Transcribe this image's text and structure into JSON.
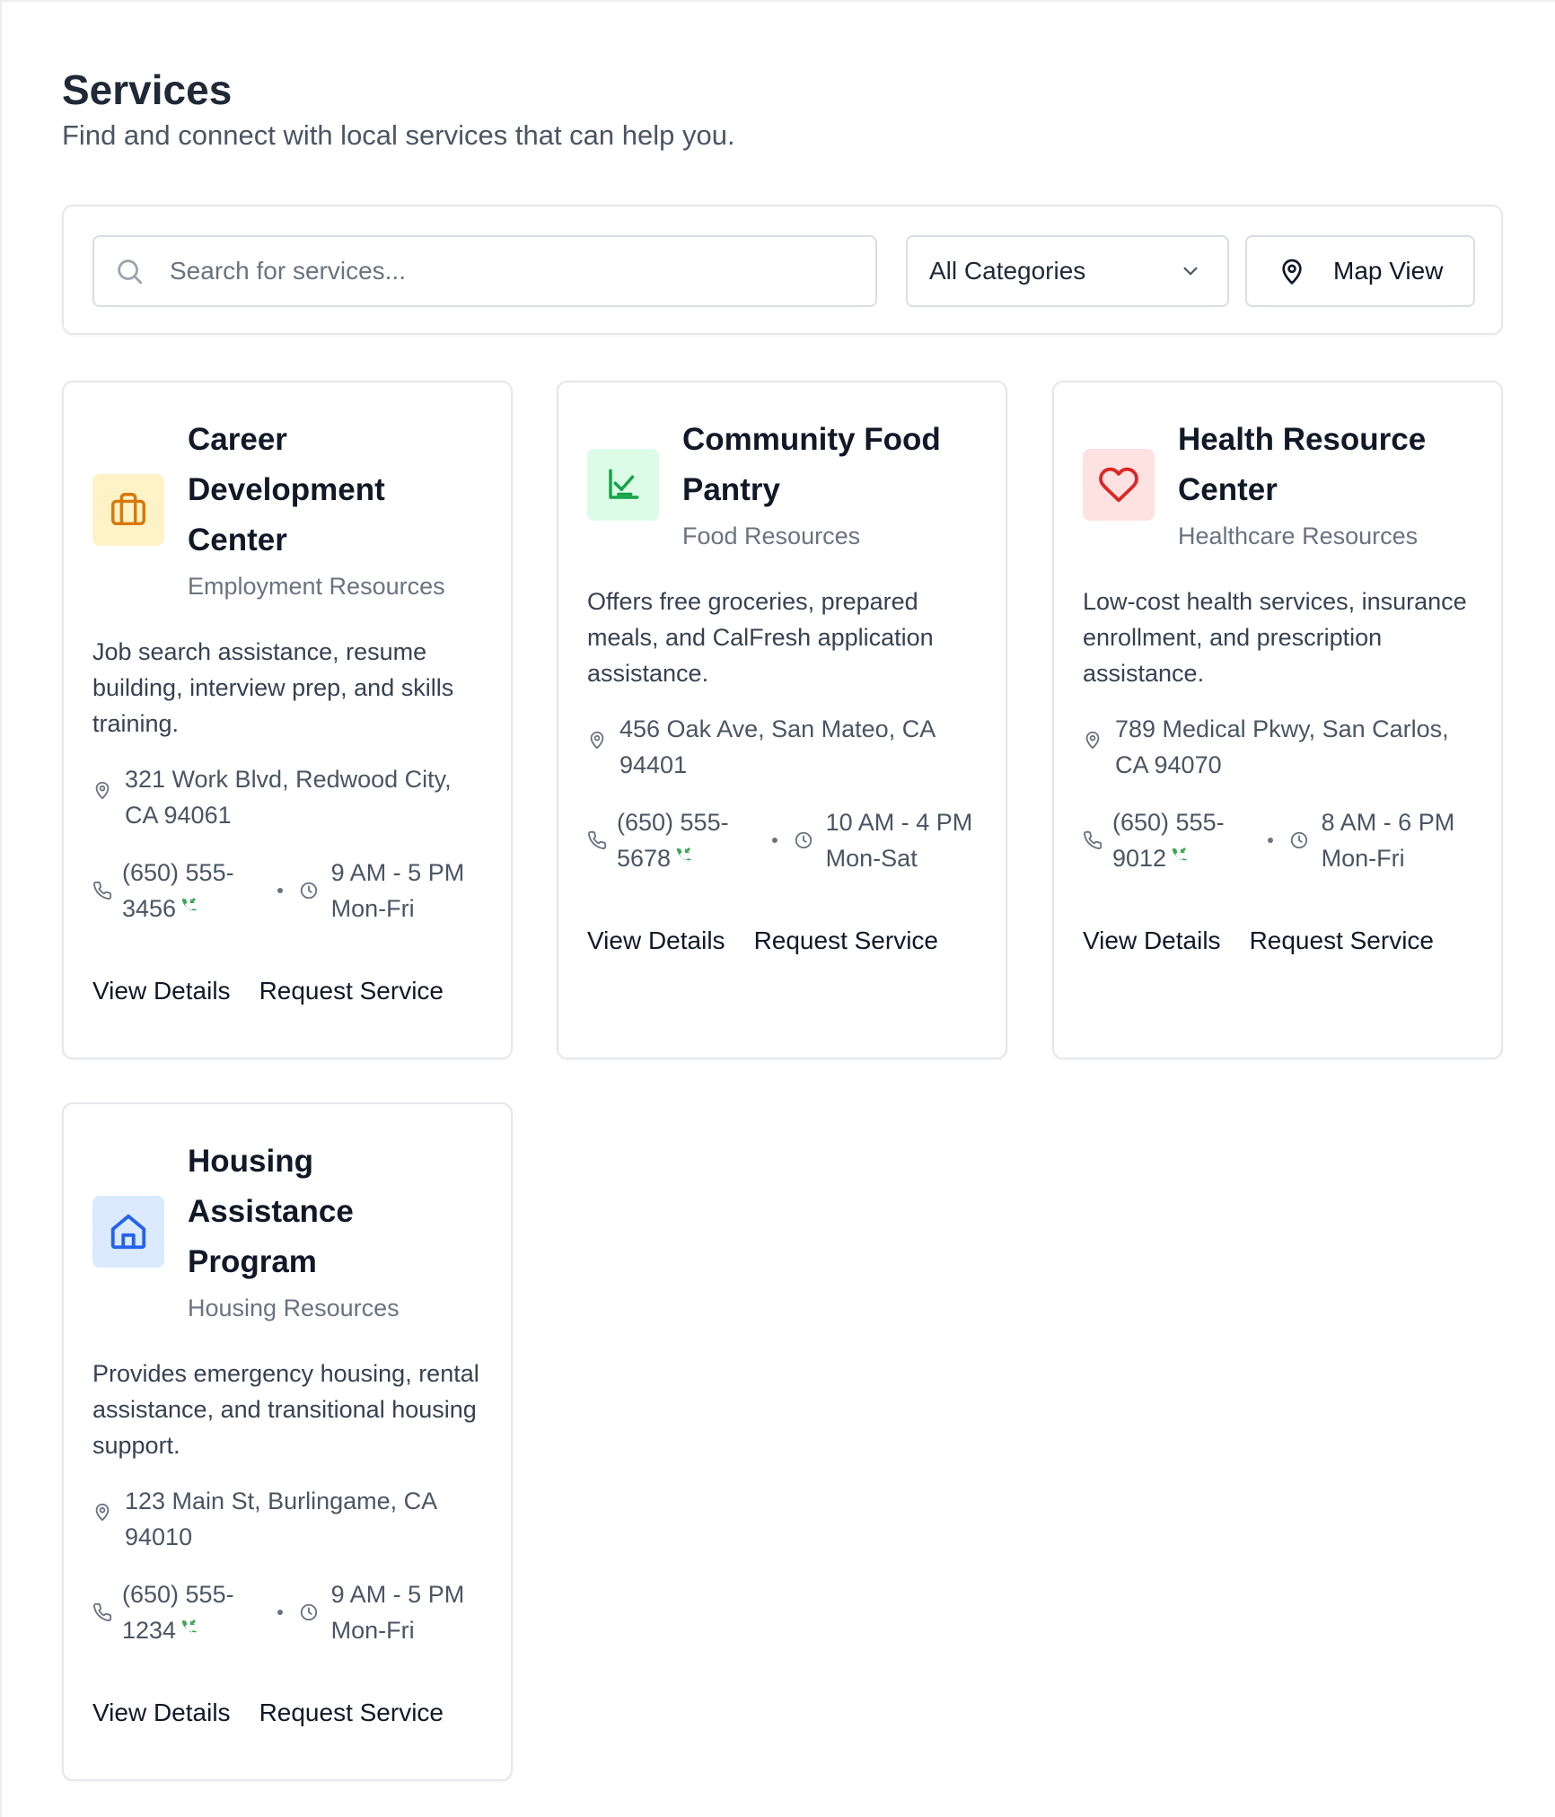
{
  "header": {
    "title": "Services",
    "subtitle": "Find and connect with local services that can help you."
  },
  "toolbar": {
    "search_placeholder": "Search for services...",
    "search_value": "",
    "category_selected": "All Categories",
    "map_view_label": "Map View"
  },
  "cards": [
    {
      "title_lines": [
        "Career",
        "Development",
        "Center"
      ],
      "category": "Employment Resources",
      "description": "Job search assistance, resume building, interview prep, and skills training.",
      "address_lines": [
        "321 Work Blvd, Redwood City,",
        "CA 94061"
      ],
      "phone_lines": [
        "(650) 555-",
        "3456"
      ],
      "hours_lines": [
        "9 AM - 5 PM",
        "Mon-Fri"
      ],
      "icon": "briefcase-icon",
      "icon_bg": "#fef3c7",
      "icon_color": "#d97706",
      "view_label": "View Details",
      "request_label": "Request Service"
    },
    {
      "title_lines": [
        "Community Food",
        "Pantry"
      ],
      "category": "Food Resources",
      "description": "Offers free groceries, prepared meals, and CalFresh application assistance.",
      "address_lines": [
        "456 Oak Ave, San Mateo, CA",
        "94401"
      ],
      "phone_lines": [
        "(650) 555-",
        "5678"
      ],
      "hours_lines": [
        "10 AM - 4 PM",
        "Mon-Sat"
      ],
      "icon": "salad-icon",
      "icon_bg": "#dcfce7",
      "icon_color": "#16a34a",
      "view_label": "View Details",
      "request_label": "Request Service"
    },
    {
      "title_lines": [
        "Health Resource",
        "Center"
      ],
      "category": "Healthcare Resources",
      "description": "Low-cost health services, insurance enrollment, and prescription assistance.",
      "address_lines": [
        "789 Medical Pkwy, San Carlos,",
        "CA 94070"
      ],
      "phone_lines": [
        "(650) 555-",
        "9012"
      ],
      "hours_lines": [
        "8 AM - 6 PM",
        "Mon-Fri"
      ],
      "icon": "heart-icon",
      "icon_bg": "#fee2e2",
      "icon_color": "#dc2626",
      "view_label": "View Details",
      "request_label": "Request Service"
    },
    {
      "title_lines": [
        "Housing",
        "Assistance",
        "Program"
      ],
      "category": "Housing Resources",
      "description": "Provides emergency housing, rental assistance, and transitional housing support.",
      "address_lines": [
        "123 Main St, Burlingame, CA",
        "94010"
      ],
      "phone_lines": [
        "(650) 555-",
        "1234"
      ],
      "hours_lines": [
        "9 AM - 5 PM",
        "Mon-Fri"
      ],
      "icon": "home-icon",
      "icon_bg": "#dbeafe",
      "icon_color": "#2563eb",
      "view_label": "View Details",
      "request_label": "Request Service"
    }
  ]
}
